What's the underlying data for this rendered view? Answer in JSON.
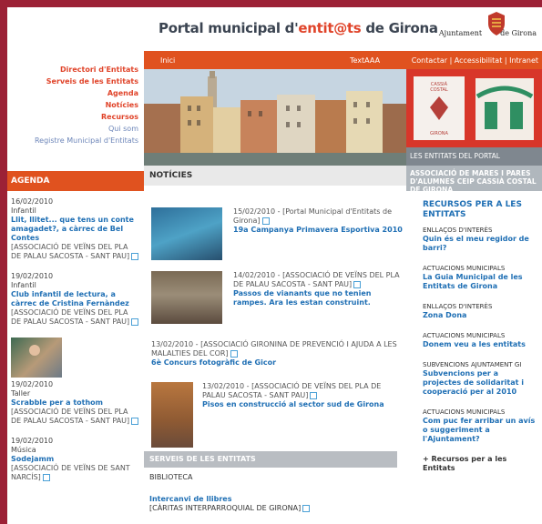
{
  "header": {
    "title_prefix": "Portal municipal d'",
    "title_highlight": "entit@ts",
    "title_suffix": " de Girona",
    "ajuntament": "Ajuntament",
    "ajuntament_suffix": "de Girona"
  },
  "nav": {
    "inici": "Inici",
    "text": "TextAAA",
    "links": "Contactar | Accessibilitat | Intranet"
  },
  "leftnav": {
    "items": [
      {
        "label": "Directori d'Entitats"
      },
      {
        "label": "Serveis de les Entitats"
      },
      {
        "label": "Agenda"
      },
      {
        "label": "Notícies"
      },
      {
        "label": "Recursos"
      },
      {
        "label": "Qui som"
      },
      {
        "label": "Registre Municipal d'Entitats"
      }
    ]
  },
  "agenda": {
    "heading": "AGENDA",
    "events": [
      {
        "date": "16/02/2010",
        "category": "Infantil",
        "title": "Llit, llitet... que tens un conte amagadet?, a càrrec de Bel Contes",
        "org": "[ASSOCIACIÓ DE VEÏNS DEL PLA DE PALAU SACOSTA - SANT PAU]"
      },
      {
        "date": "19/02/2010",
        "category": "Infantil",
        "title": "Club infantil de lectura, a càrrec de Cristina Fernàndez",
        "org": "[ASSOCIACIÓ DE VEÏNS DEL PLA DE PALAU SACOSTA - SANT PAU]"
      },
      {
        "date": "19/02/2010",
        "category": "Taller",
        "title": "Scrabble per a tothom",
        "org": "[ASSOCIACIÓ DE VEÏNS DEL PLA DE PALAU SACOSTA - SANT PAU]"
      },
      {
        "date": "19/02/2010",
        "category": "Música",
        "title": "Sodejamm",
        "org": "[ASSOCIACIÓ DE VEÏNS DE SANT NARCÍS]"
      }
    ]
  },
  "news": {
    "heading": "NOTÍCIES",
    "items": [
      {
        "meta": "15/02/2010 - [Portal Municipal d'Entitats de Girona]",
        "title": "19a Campanya Primavera Esportiva 2010"
      },
      {
        "meta": "14/02/2010 - [ASSOCIACIÓ DE VEÏNS DEL PLA DE PALAU SACOSTA - SANT PAU]",
        "title": "Passos de vianants que no tenien rampes. Ara les estan construint."
      },
      {
        "meta": "13/02/2010 - [ASSOCIACIÓ GIRONINA DE PREVENCIÓ I AJUDA A LES MALALTIES DEL COR]",
        "title": "6è Concurs fotogràfic de Gicor"
      },
      {
        "meta": "13/02/2010 - [ASSOCIACIÓ DE VEÏNS DEL PLA DE PALAU SACOSTA - SANT PAU]",
        "title": "Pisos en construcció al sector sud de Girona"
      }
    ]
  },
  "serveis": {
    "heading": "SERVEIS DE LES ENTITATS",
    "category": "BIBLIOTECA",
    "title": "Intercanvi de llibres",
    "org": "[CÀRITAS INTERPARROQUIAL DE GIRONA]"
  },
  "promo": {
    "entitats_label": "LES ENTITATS DEL PORTAL",
    "ampa": "ASSOCIACIÓ DE MARES I PARES D'ALUMNES CEIP CASSIÀ COSTAL DE GIRONA",
    "card_line1": "CASSIÀ",
    "card_line2": "COSTAL",
    "card_bottom": "GIRONA"
  },
  "recursos": {
    "heading": "RECURSOS PER A LES ENTITATS",
    "items": [
      {
        "category": "ENLLAÇOS D'INTERÈS",
        "title": "Quin és el meu regidor de barri?"
      },
      {
        "category": "ACTUACIONS MUNICIPALS",
        "title": "La Guia Municipal de les Entitats de Girona"
      },
      {
        "category": "ENLLAÇOS D'INTERÈS",
        "title": "Zona Dona"
      },
      {
        "category": "ACTUACIONS MUNICIPALS",
        "title": "Donem veu a les entitats"
      },
      {
        "category": "SUBVENCIONS AJUNTAMENT GI",
        "title": "Subvencions per a projectes de solidaritat i cooperació per al 2010"
      },
      {
        "category": "ACTUACIONS MUNICIPALS",
        "title": "Com puc fer arribar un avís o suggeriment a l'Ajuntament?"
      }
    ],
    "more": "+ Recursos per a les Entitats"
  }
}
